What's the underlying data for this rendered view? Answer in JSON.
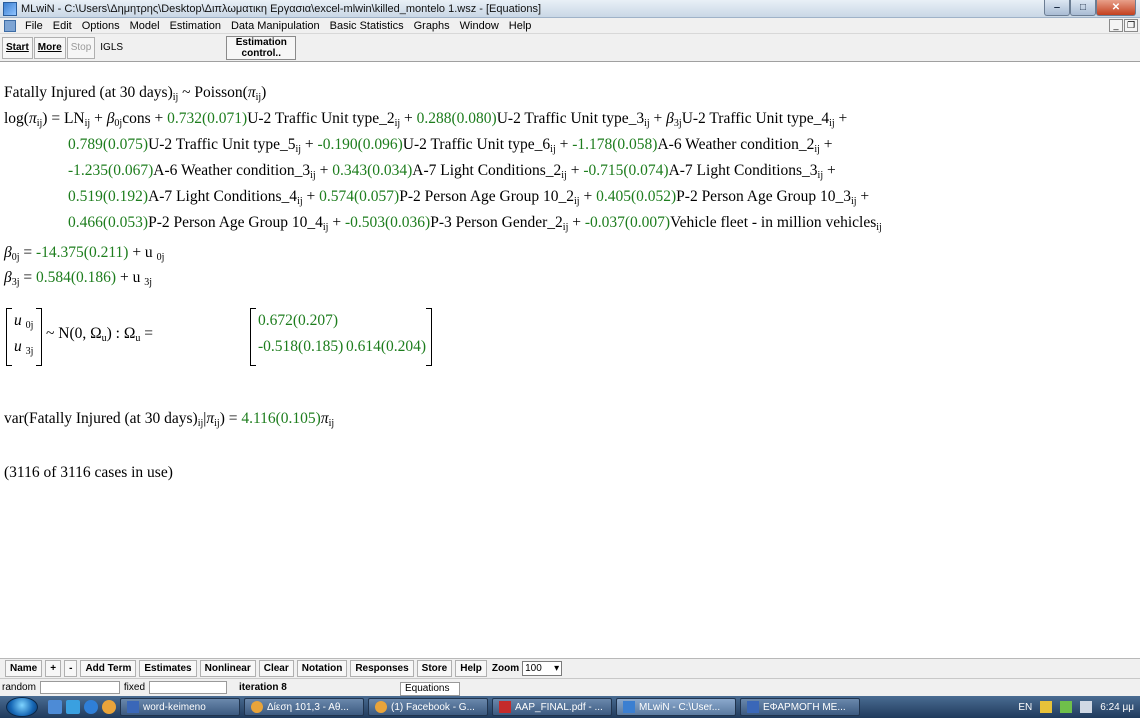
{
  "window": {
    "title": "MLwiN - C:\\Users\\Δημητρης\\Desktop\\Διπλωματικη Εργασια\\excel-mlwin\\killed_montelo 1.wsz - [Equations]"
  },
  "menu": [
    "File",
    "Edit",
    "Options",
    "Model",
    "Estimation",
    "Data Manipulation",
    "Basic Statistics",
    "Graphs",
    "Window",
    "Help"
  ],
  "toolbar": {
    "start": "Start",
    "more": "More",
    "stop": "Stop",
    "method": "IGLS",
    "estimation_control_line1": "Estimation",
    "estimation_control_line2": "control.."
  },
  "equations": {
    "l1": {
      "a": "Fatally Injured (at 30 days)",
      "b": " ~ Poisson(",
      "c": ")"
    },
    "l2": {
      "a": "log(",
      "b": ") = LN",
      "c": " + ",
      "d": "cons + ",
      "e": "0.732(0.071)",
      "f": "U-2 Traffic Unit type_2",
      "g": " + ",
      "h": "0.288(0.080)",
      "i": "U-2 Traffic Unit type_3",
      "j": " + ",
      "k": "U-2 Traffic Unit type_4",
      "l": " +"
    },
    "l3": {
      "a": "0.789(0.075)",
      "b": "U-2 Traffic Unit type_5",
      "c": " + ",
      "d": "-0.190(0.096)",
      "e": "U-2 Traffic Unit type_6",
      "f": " + ",
      "g": "-1.178(0.058)",
      "h": "A-6 Weather condition_2",
      "i": " +"
    },
    "l4": {
      "a": "-1.235(0.067)",
      "b": "A-6 Weather condition_3",
      "c": " + ",
      "d": "0.343(0.034)",
      "e": "A-7 Light Conditions_2",
      "f": " + ",
      "g": "-0.715(0.074)",
      "h": "A-7 Light Conditions_3",
      "i": " +"
    },
    "l5": {
      "a": "0.519(0.192)",
      "b": "A-7 Light Conditions_4",
      "c": " + ",
      "d": "0.574(0.057)",
      "e": "P-2 Person Age Group 10_2",
      "f": " + ",
      "g": "0.405(0.052)",
      "h": "P-2 Person Age Group 10_3",
      "i": " +"
    },
    "l6": {
      "a": "0.466(0.053)",
      "b": "P-2 Person Age Group 10_4",
      "c": " + ",
      "d": "-0.503(0.036)",
      "e": "P-3 Person Gender_2",
      "f": " + ",
      "g": "-0.037(0.007)",
      "h": "Vehicle fleet - in million vehicles"
    },
    "beta0": {
      "a": " = ",
      "b": "-14.375(0.211)",
      "c": " + u "
    },
    "beta3": {
      "a": " = ",
      "b": "0.584(0.186)",
      "c": " + u "
    },
    "matrix": {
      "u0": "u ",
      "u3": "u ",
      "dist": " ~ N(0,  Ω",
      "dist_end": ")  :  Ω",
      "eq": " = ",
      "m11": "0.672(0.207)",
      "m21": "-0.518(0.185)",
      "m22": "0.614(0.204)"
    },
    "var": {
      "a": "var(Fatally Injured (at 30 days)",
      "b": "|",
      "c": ") = ",
      "d": "4.116(0.105)"
    },
    "cases": "(3116 of 3116 cases in use)",
    "sym": {
      "pi": "π",
      "beta": "β",
      "ij": "ij",
      "j": "j",
      "u": "u",
      "zero_j": "0j",
      "three_j": "3j",
      "zero": "0",
      "three": "3"
    }
  },
  "commands": [
    "Name",
    "+",
    "-",
    "Add Term",
    "Estimates",
    "Nonlinear",
    "Clear",
    "Notation",
    "Responses",
    "Store",
    "Help"
  ],
  "zoom": {
    "label": "Zoom",
    "value": "100"
  },
  "status": {
    "random": "random",
    "fixed": "fixed",
    "iteration": "iteration 8",
    "tab": "Equations"
  },
  "taskbar": {
    "tasks": [
      "word-keimeno",
      "Δίεση 101,3 - Αθ...",
      "(1) Facebook - G...",
      "AAP_FINAL.pdf - ...",
      "MLwiN - C:\\User...",
      "ΕΦΑΡΜΟΓΗ ΜΕ..."
    ],
    "lang": "EN",
    "clock": "6:24 μμ"
  },
  "colors": {
    "estimate": "#1d7d1d",
    "taskbar": "#2b4a70"
  }
}
